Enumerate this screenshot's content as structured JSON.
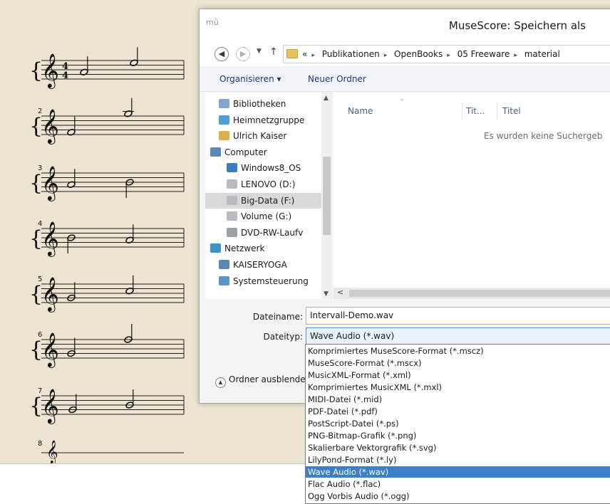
{
  "score": {
    "system_numbers": [
      "2",
      "3",
      "4",
      "5",
      "6",
      "7",
      "8"
    ],
    "time_signature": {
      "top": "4",
      "bottom": "4"
    }
  },
  "dialog": {
    "title": "MuseScore: Speichern als",
    "app_icon": "mû",
    "breadcrumb": {
      "prefix": "«",
      "items": [
        "Publikationen",
        "OpenBooks",
        "05 Freeware",
        "material"
      ]
    },
    "toolbar": {
      "organize_label": "Organisieren ▾",
      "new_folder_label": "Neuer Ordner"
    },
    "nav_items": [
      {
        "label": "Bibliotheken",
        "icon": "libraries-icon"
      },
      {
        "label": "Heimnetzgruppe",
        "icon": "homegroup-icon"
      },
      {
        "label": "Ulrich Kaiser",
        "icon": "user-folder-icon"
      },
      {
        "label": "Computer",
        "icon": "computer-icon"
      },
      {
        "label": "Windows8_OS",
        "icon": "os-drive-icon"
      },
      {
        "label": "LENOVO (D:)",
        "icon": "drive-icon"
      },
      {
        "label": "Big-Data (F:)",
        "icon": "drive-icon"
      },
      {
        "label": "Volume (G:)",
        "icon": "drive-icon"
      },
      {
        "label": "DVD-RW-Laufv",
        "icon": "dvd-drive-icon"
      },
      {
        "label": "Netzwerk",
        "icon": "network-icon"
      },
      {
        "label": "KAISERYOGA",
        "icon": "network-computer-icon"
      },
      {
        "label": "Systemsteuerung",
        "icon": "control-panel-icon"
      }
    ],
    "selected_nav": "Big-Data (F:)",
    "columns": {
      "name": "Name",
      "tit": "Tit...",
      "titel": "Titel"
    },
    "empty_message": "Es wurden keine Suchergeb",
    "filename_label": "Dateiname:",
    "filename_value": "Intervall-Demo.wav",
    "filetype_label": "Dateityp:",
    "filetype_value": "Wave Audio (*.wav)",
    "collapse_label": "Ordner ausblenden",
    "filetype_options": [
      "Komprimiertes MuseScore-Format (*.mscz)",
      "MuseScore-Format (*.mscx)",
      "MusicXML-Format (*.xml)",
      "Komprimiertes MusicXML (*.mxl)",
      "MIDI-Datei (*.mid)",
      "PDF-Datei (*.pdf)",
      "PostScript-Datei (*.ps)",
      "PNG-Bitmap-Grafik (*.png)",
      "Skalierbare Vektorgrafik (*.svg)",
      "LilyPond-Format (*.ly)",
      "Wave Audio (*.wav)",
      "Flac Audio (*.flac)",
      "Ogg Vorbis Audio (*.ogg)"
    ],
    "selected_option": "Wave Audio (*.wav)"
  },
  "colors": {
    "score_background": "#ede5d2",
    "selection_blue": "#3c7fc6",
    "link_blue": "#1a3e6e"
  }
}
